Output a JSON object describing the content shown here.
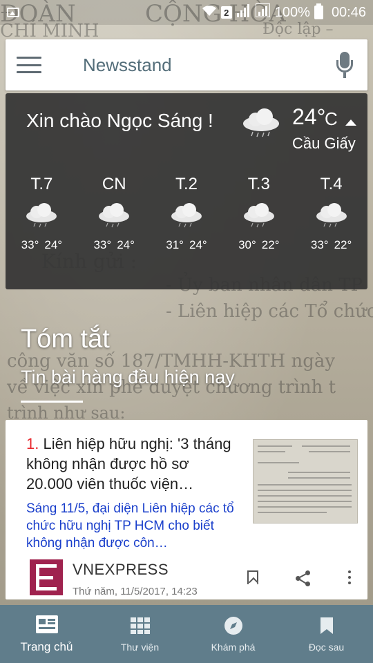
{
  "status_bar": {
    "sim": "2",
    "battery": "100%",
    "time": "00:46"
  },
  "search_bar": {
    "title": "Newsstand"
  },
  "weather": {
    "greeting": "Xin chào Ngọc Sáng !",
    "current_temp": "24°",
    "unit": "C",
    "location": "Cầu Giấy",
    "forecast": [
      {
        "day": "T.7",
        "high": "33°",
        "low": "24°"
      },
      {
        "day": "CN",
        "high": "33°",
        "low": "24°"
      },
      {
        "day": "T.2",
        "high": "31°",
        "low": "24°"
      },
      {
        "day": "T.3",
        "high": "30°",
        "low": "22°"
      },
      {
        "day": "T.4",
        "high": "33°",
        "low": "22°"
      }
    ]
  },
  "summary": {
    "title": "Tóm tắt",
    "subtitle": "Tin bài hàng đầu hiện nay"
  },
  "article": {
    "number": "1.",
    "headline": "Liên hiệp hữu nghị: '3 tháng không nhận được hồ sơ 20.000 viên thuốc viện…",
    "snippet": "Sáng 11/5, đại diện Liên hiệp các tổ chức hữu nghị TP HCM cho biết không nhận được côn…",
    "source": "VNEXPRESS",
    "date": "Thứ năm, 11/5/2017, 14:23"
  },
  "bottom_nav": {
    "items": [
      {
        "label": "Trang chủ",
        "icon": "home-icon"
      },
      {
        "label": "Thư viện",
        "icon": "grid-icon"
      },
      {
        "label": "Khám phá",
        "icon": "compass-icon"
      },
      {
        "label": "Đọc sau",
        "icon": "bookmark-icon"
      }
    ]
  },
  "colors": {
    "nav_bg": "#607d8b",
    "weather_bg": "#343434",
    "link_blue": "#1a3fcb",
    "number_red": "#e8282e",
    "vnexpress": "#9f224e"
  }
}
